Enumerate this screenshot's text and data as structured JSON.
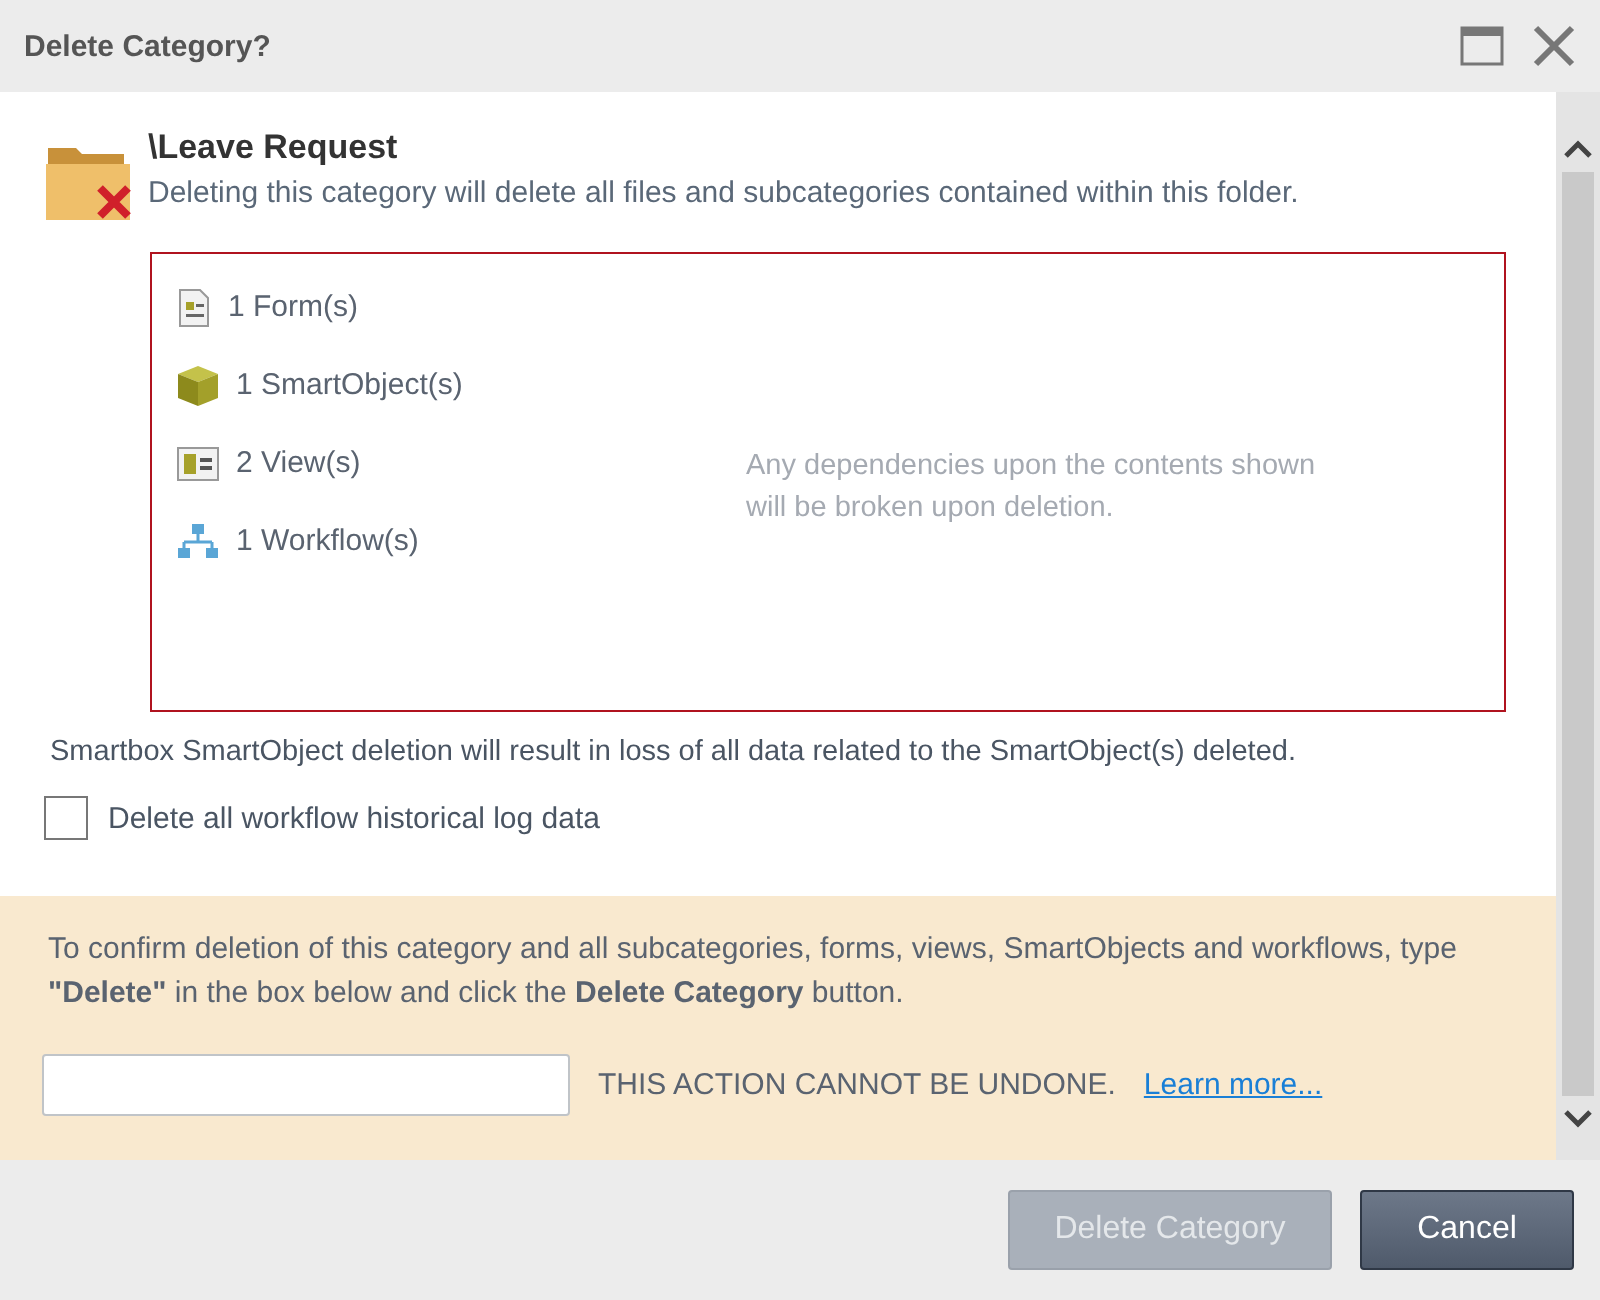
{
  "window": {
    "title": "Delete Category?"
  },
  "header": {
    "title": "\\Leave Request",
    "description": "Deleting this category will delete all files and subcategories contained within this folder."
  },
  "contents": {
    "items": [
      {
        "kind": "form",
        "label": "1 Form(s)"
      },
      {
        "kind": "smartobject",
        "label": "1 SmartObject(s)"
      },
      {
        "kind": "view",
        "label": "2 View(s)"
      },
      {
        "kind": "workflow",
        "label": "1 Workflow(s)"
      }
    ],
    "note": "Any dependencies upon the contents shown will be broken upon deletion."
  },
  "smartbox_note": "Smartbox SmartObject deletion will result in loss of all data related to the SmartObject(s) deleted.",
  "checkbox": {
    "label": "Delete all workflow historical log data",
    "checked": false
  },
  "confirm": {
    "instructions": "To confirm deletion of this category and all subcategories, forms, views, SmartObjects and workflows, type **\"Delete\"** in the box below and click the **Delete Category** button.",
    "warning": "THIS ACTION CANNOT BE UNDONE.",
    "link": "Learn more..."
  },
  "buttons": [
    {
      "label": "Delete Category",
      "kind": "primary",
      "disabled": true
    },
    {
      "label": "Cancel",
      "kind": "secondary",
      "disabled": false
    }
  ]
}
